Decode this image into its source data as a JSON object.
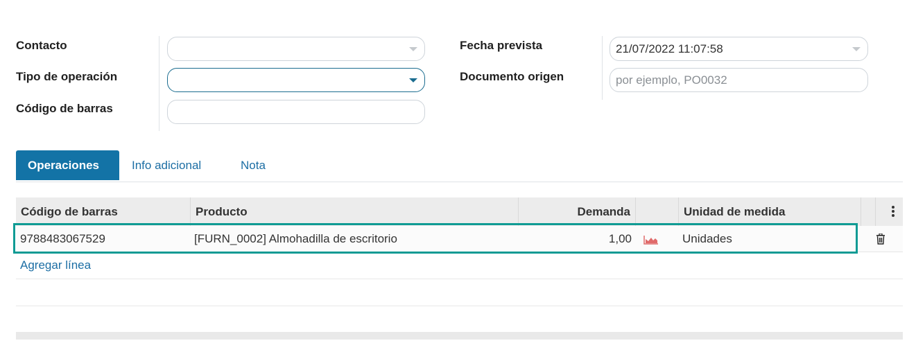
{
  "form": {
    "contacto_label": "Contacto",
    "tipo_operacion_label": "Tipo de operación",
    "codigo_barras_label": "Código de barras",
    "fecha_prevista_label": "Fecha prevista",
    "fecha_prevista_value": "21/07/2022 11:07:58",
    "documento_origen_label": "Documento origen",
    "documento_origen_placeholder": "por ejemplo, PO0032"
  },
  "tabs": [
    {
      "label": "Operaciones",
      "active": true
    },
    {
      "label": "Info adicional",
      "active": false
    },
    {
      "label": "Nota",
      "active": false
    }
  ],
  "table": {
    "headers": {
      "barcode": "Código de barras",
      "product": "Producto",
      "demand": "Demanda",
      "uom": "Unidad de medida"
    },
    "rows": [
      {
        "barcode": "9788483067529",
        "product": "[FURN_0002] Almohadilla de escritorio",
        "demand": "1,00",
        "uom": "Unidades"
      }
    ],
    "add_line": "Agregar línea"
  },
  "colors": {
    "accent": "#1373a6",
    "link": "#1c6ea4",
    "highlight": "#0f9b94",
    "forecast_icon": "#e06a6a"
  },
  "icons": {
    "forecast": "area-chart-icon",
    "delete": "trash-icon",
    "options": "vertical-ellipsis-icon",
    "dropdown": "caret-down-icon"
  }
}
